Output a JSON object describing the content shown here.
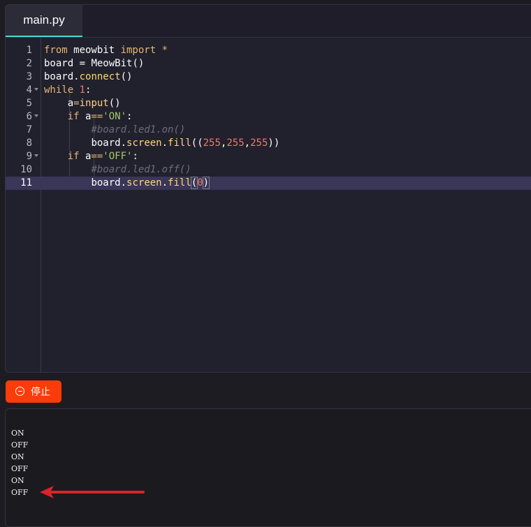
{
  "editor": {
    "tab_label": "main.py",
    "lines": [
      {
        "n": "1"
      },
      {
        "n": "2"
      },
      {
        "n": "3"
      },
      {
        "n": "4"
      },
      {
        "n": "5"
      },
      {
        "n": "6"
      },
      {
        "n": "7"
      },
      {
        "n": "8"
      },
      {
        "n": "9"
      },
      {
        "n": "10"
      },
      {
        "n": "11"
      }
    ],
    "code": {
      "l1": [
        "from",
        " meowbit ",
        "import",
        " *"
      ],
      "l2": [
        "board",
        " = ",
        "MeowBit",
        "()"
      ],
      "l3": [
        "board",
        ".",
        "connect",
        "()"
      ],
      "l4": [
        "while",
        " ",
        "1",
        ":"
      ],
      "l5": [
        "a",
        "=",
        "input",
        "()"
      ],
      "l6": [
        "if",
        " a",
        "==",
        "'ON'",
        ":"
      ],
      "l7": [
        "#board.led1.on()"
      ],
      "l8": [
        "board",
        ".",
        "screen",
        ".",
        "fill",
        "((",
        "255",
        ",",
        "255",
        ",",
        "255",
        "))"
      ],
      "l9": [
        "if",
        " a",
        "==",
        "'OFF'",
        ":"
      ],
      "l10": [
        "#board.led1.off()"
      ],
      "l11": [
        "board",
        ".",
        "screen",
        ".",
        "fill",
        "(",
        "0",
        ")"
      ]
    }
  },
  "controls": {
    "stop_label": "停止"
  },
  "console": {
    "output": [
      "ON",
      "OFF",
      "ON",
      "OFF",
      "ON",
      "OFF"
    ]
  },
  "colors": {
    "accent_tab": "#4fd6d8",
    "stop_button": "#fa3c0a",
    "arrow": "#e0202a"
  }
}
